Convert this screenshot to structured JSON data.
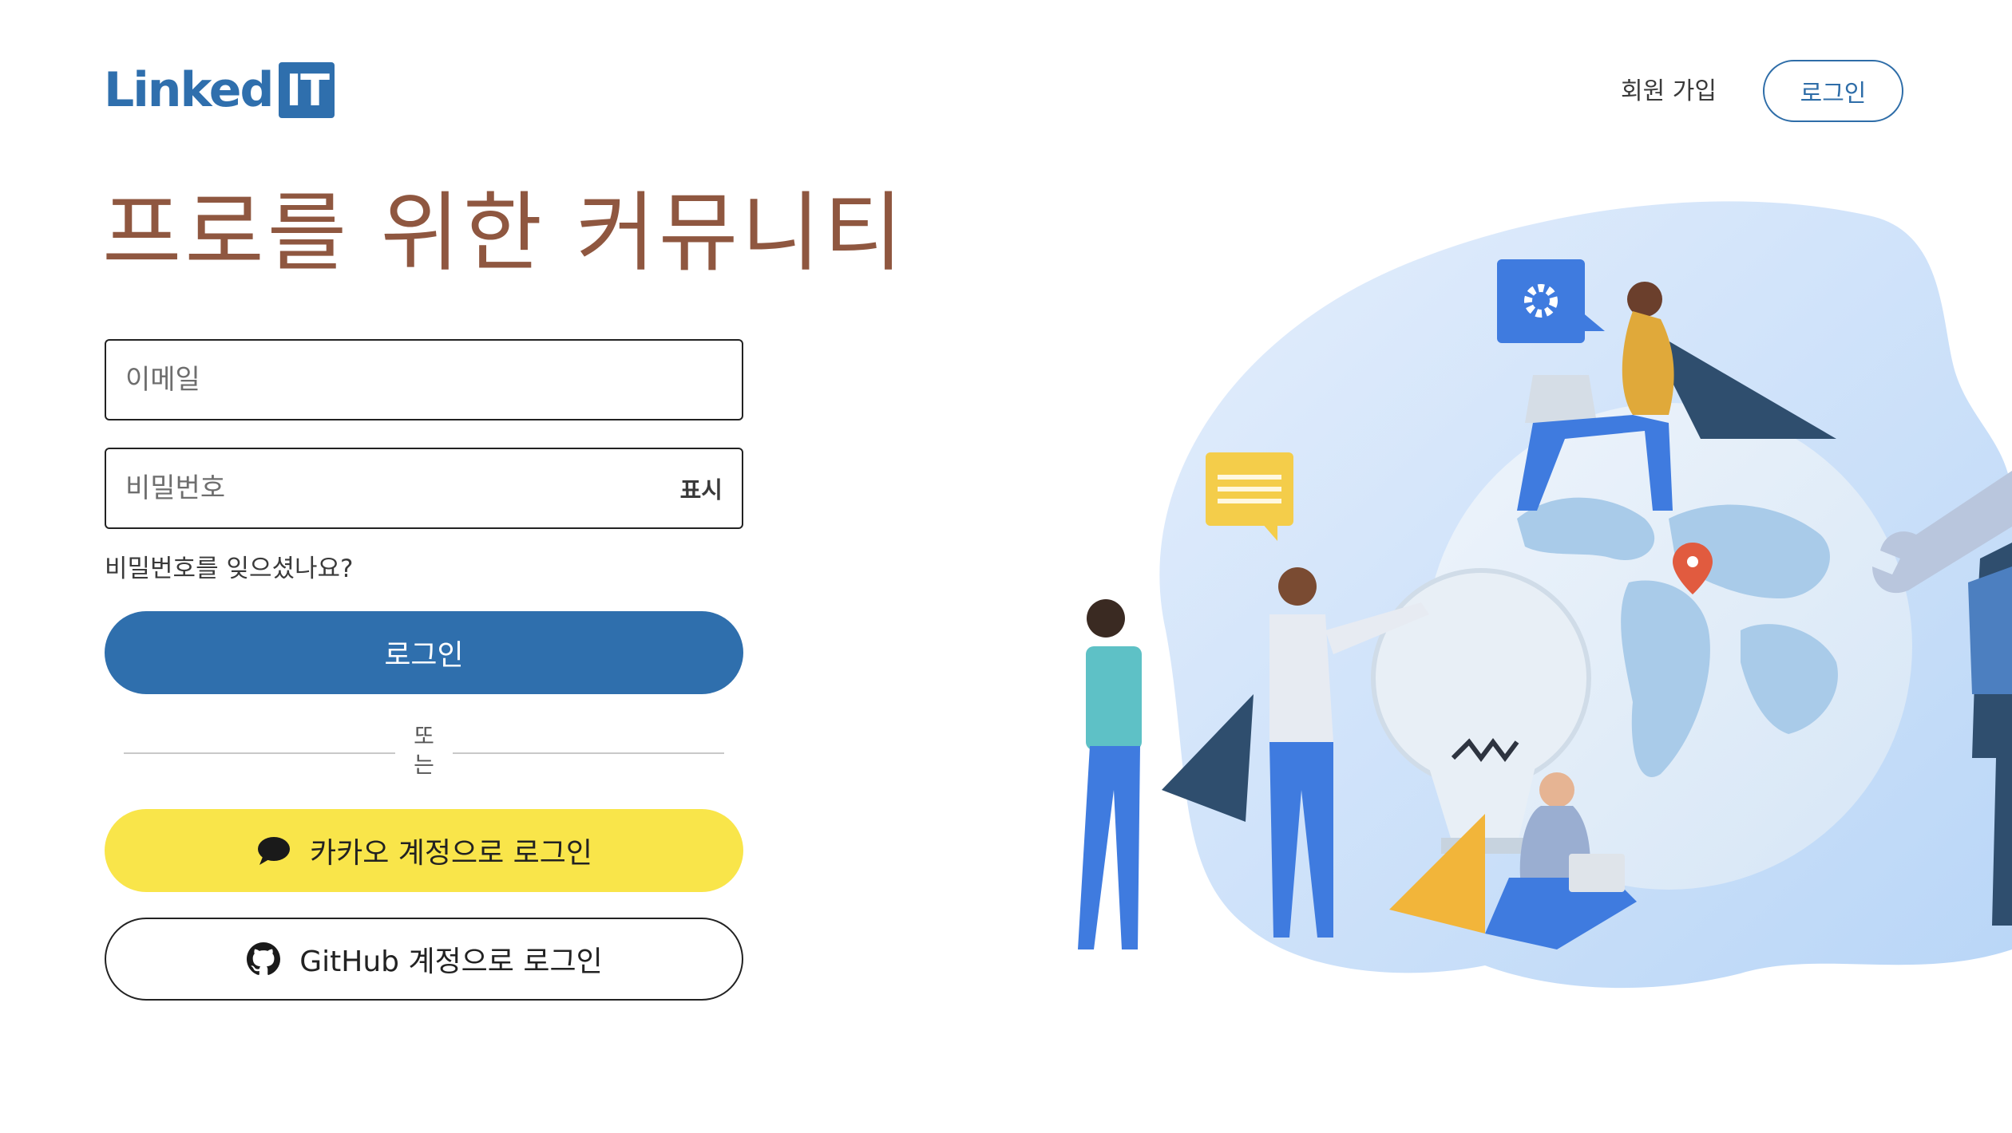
{
  "header": {
    "logo": {
      "word": "Linked",
      "box": "IT"
    },
    "signup_label": "회원 가입",
    "login_label": "로그인"
  },
  "headline": "프로를 위한 커뮤니티",
  "form": {
    "email_placeholder": "이메일",
    "password_placeholder": "비밀번호",
    "show_label": "표시",
    "forgot_label": "비밀번호를 잊으셨나요?",
    "login_button": "로그인",
    "divider_text": "또는",
    "kakao_button": "카카오 계정으로 로그인",
    "github_button": "GitHub 계정으로 로그인"
  },
  "icons": {
    "kakao": "chat-bubble-icon",
    "github": "github-icon",
    "settings": "gear-icon",
    "location": "map-pin-icon"
  },
  "colors": {
    "brand": "#2f6fad",
    "headline": "#8f5740",
    "kakao": "#f9e54a"
  }
}
